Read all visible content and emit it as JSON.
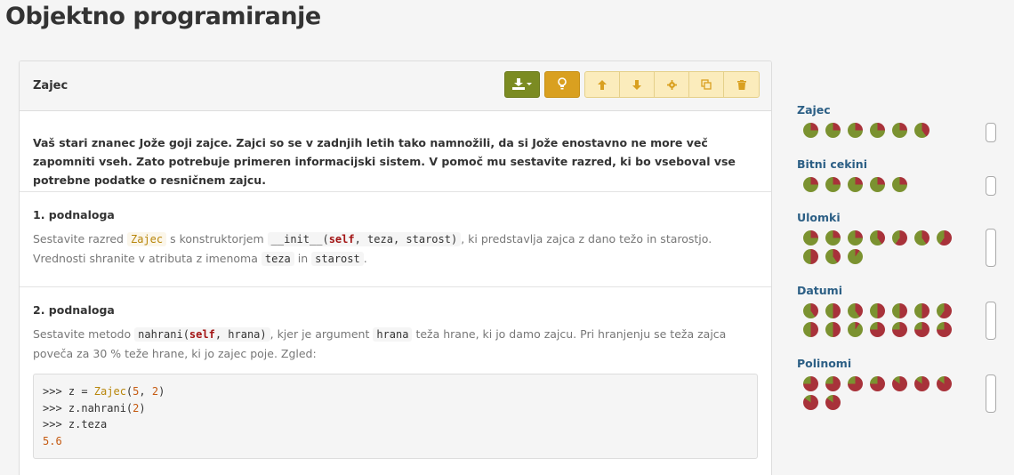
{
  "page": {
    "title": "Objektno programiranje"
  },
  "problem": {
    "title": "Zajec",
    "icons": [
      "download-icon",
      "lightbulb-icon",
      "arrow-up-icon",
      "arrow-down-icon",
      "gear-icon",
      "copy-icon",
      "trash-icon"
    ],
    "intro": "Vaš stari znanec Jože goji zajce. Zajci so se v zadnjih letih tako namnožili, da si Jože enostavno ne more več zapomniti vseh. Zato potrebuje primeren informacijski sistem. V pomoč mu sestavite razred, ki bo vseboval vse potrebne podatke o resničnem zajcu.",
    "parts": [
      {
        "heading": "1. podnaloga",
        "t1": "Sestavite razred",
        "c_class": "Zajec",
        "t2": "s konstruktorjem",
        "c_init_pre": "__init__(",
        "c_init_self": "self",
        "c_init_post": ", teza, starost)",
        "t3": ", ki predstavlja zajca z dano težo in starostjo. Vrednosti shranite v atributa z imenoma",
        "c_teza": "teza",
        "t4": "in",
        "c_starost": "starost",
        "t5": "."
      },
      {
        "heading": "2. podnaloga",
        "t1": "Sestavite metodo",
        "c_method_pre": "nahrani(",
        "c_method_self": "self",
        "c_method_post": ", hrana)",
        "t2": ", kjer je argument",
        "c_hrana": "hrana",
        "t3": "teža hrane, ki jo damo zajcu. Pri hranjenju se teža zajca poveča za 30 % teže hrane, ki jo zajec poje. Zgled:",
        "code": {
          "l1_prompt": ">>> z = ",
          "l1_cls": "Zajec",
          "l1_a": "(",
          "l1_n1": "5",
          "l1_b": ", ",
          "l1_n2": "2",
          "l1_c": ")",
          "l2_prompt": ">>> z.nahrani(",
          "l2_n": "2",
          "l2_c": ")",
          "l3": ">>> z.teza",
          "l4": "5.6"
        }
      }
    ]
  },
  "sidebar": {
    "groups": [
      {
        "title": "Zajec",
        "fills": [
          0.75,
          0.75,
          0.75,
          0.75,
          0.75,
          0.6
        ]
      },
      {
        "title": "Bitni cekini",
        "fills": [
          0.75,
          0.75,
          0.75,
          0.75,
          0.75
        ]
      },
      {
        "title": "Ulomki",
        "fills": [
          0.75,
          0.75,
          0.75,
          0.6,
          0.4,
          0.6,
          0.4,
          0.5,
          0.6,
          0.9
        ]
      },
      {
        "title": "Datumi",
        "fills": [
          0.6,
          0.5,
          0.6,
          0.5,
          0.5,
          0.5,
          0.4,
          0.5,
          0.5,
          0.9,
          0.25,
          0.25,
          0.25,
          0.25
        ]
      },
      {
        "title": "Polinomi",
        "fills": [
          0.25,
          0.25,
          0.25,
          0.25,
          0.15,
          0.15,
          0.15,
          0.15,
          0.15
        ]
      }
    ],
    "colors": {
      "green": "#7b9230",
      "red": "#a8323a"
    }
  }
}
